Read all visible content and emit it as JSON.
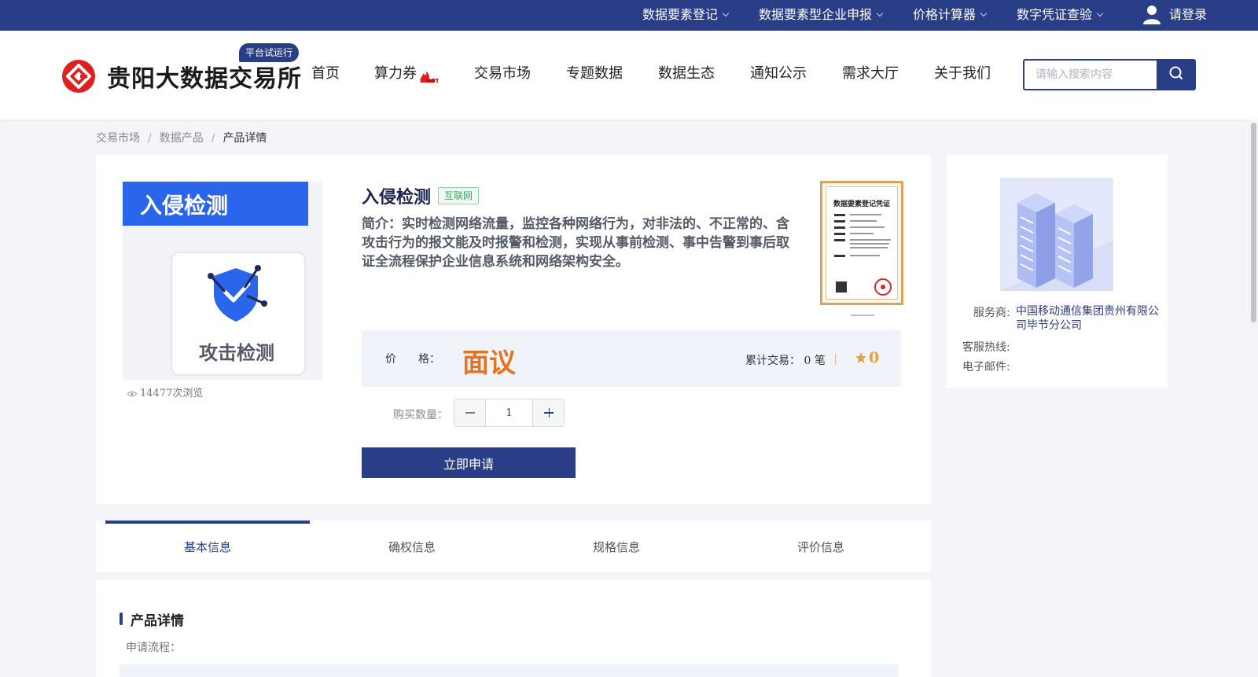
{
  "topbar": {
    "links": [
      "数据要素登记",
      "数据要素型企业申报",
      "价格计算器",
      "数字凭证查验"
    ],
    "login_label": "请登录"
  },
  "header": {
    "logo_text": "贵阳大数据交易所",
    "trial_badge": "平台试运行",
    "nav": [
      "首页",
      "算力券",
      "交易市场",
      "专题数据",
      "数据生态",
      "通知公示",
      "需求大厅",
      "关于我们"
    ],
    "hot_badge": "HOT",
    "search_placeholder": "请输入搜索内容"
  },
  "breadcrumb": [
    "交易市场",
    "数据产品",
    "产品详情"
  ],
  "product": {
    "image_title": "入侵检测",
    "image_caption": "攻击检测",
    "views": "14477次浏览",
    "title": "入侵检测",
    "tag": "互联网",
    "intro": "简介：实时检测网络流量，监控各种网络行为，对非法的、不正常的、含攻击行为的报文能及时报警和检测，实现从事前检测、事中告警到事后取证全流程保护企业信息系统和网络架构安全。",
    "certificate_title": "数据要素登记凭证",
    "price_label": "价　　格：",
    "price_value": "面议",
    "trade_label": "累计交易：",
    "trade_count": "0",
    "trade_unit": "笔",
    "rating": "0",
    "quantity_label": "购买数量：",
    "quantity_value": "1",
    "apply_label": "立即申请"
  },
  "provider": {
    "provider_label": "服务商:",
    "provider_name": "中国移动通信集团贵州有限公司毕节分公司",
    "hotline_label": "客服热线:",
    "email_label": "电子邮件:"
  },
  "tabs": [
    "基本信息",
    "确权信息",
    "规格信息",
    "评价信息"
  ],
  "detail": {
    "title": "产品详情",
    "subtitle": "申请流程："
  },
  "colors": {
    "brand": "#2a3d87",
    "price": "#e8731f",
    "rating": "#e8a23a",
    "tag": "#3aa660"
  }
}
